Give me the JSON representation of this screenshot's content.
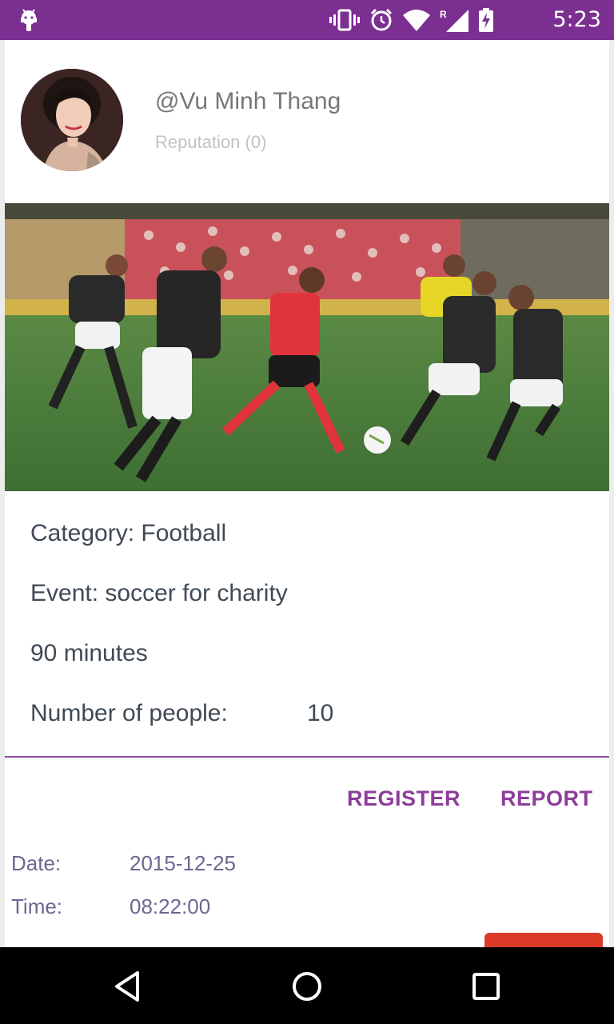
{
  "status_bar": {
    "time": "5:23",
    "icons": [
      "android-icon",
      "vibrate-icon",
      "alarm-icon",
      "wifi-icon",
      "signal-roaming-icon",
      "battery-charging-icon"
    ],
    "roaming_label": "R"
  },
  "profile": {
    "username": "@Vu Minh Thang",
    "reputation": "Reputation (0)"
  },
  "event": {
    "category": "Category: Football",
    "event_name": "Event: soccer for charity",
    "duration": "90 minutes",
    "people_label": "Number of people:",
    "people_value": "10"
  },
  "actions": {
    "register": "REGISTER",
    "report": "REPORT"
  },
  "meta": {
    "date_label": "Date:",
    "date_value": "2015-12-25",
    "time_label": "Time:",
    "time_value": "08:22:00"
  },
  "nav_bar": {
    "icons": [
      "back-icon",
      "home-icon",
      "recents-icon"
    ]
  },
  "colors": {
    "status_bar": "#7b2f91",
    "accent": "#8d3d9a",
    "text": "#3f4a55",
    "meta_text": "#6f6690",
    "red_button": "#db3a29"
  }
}
